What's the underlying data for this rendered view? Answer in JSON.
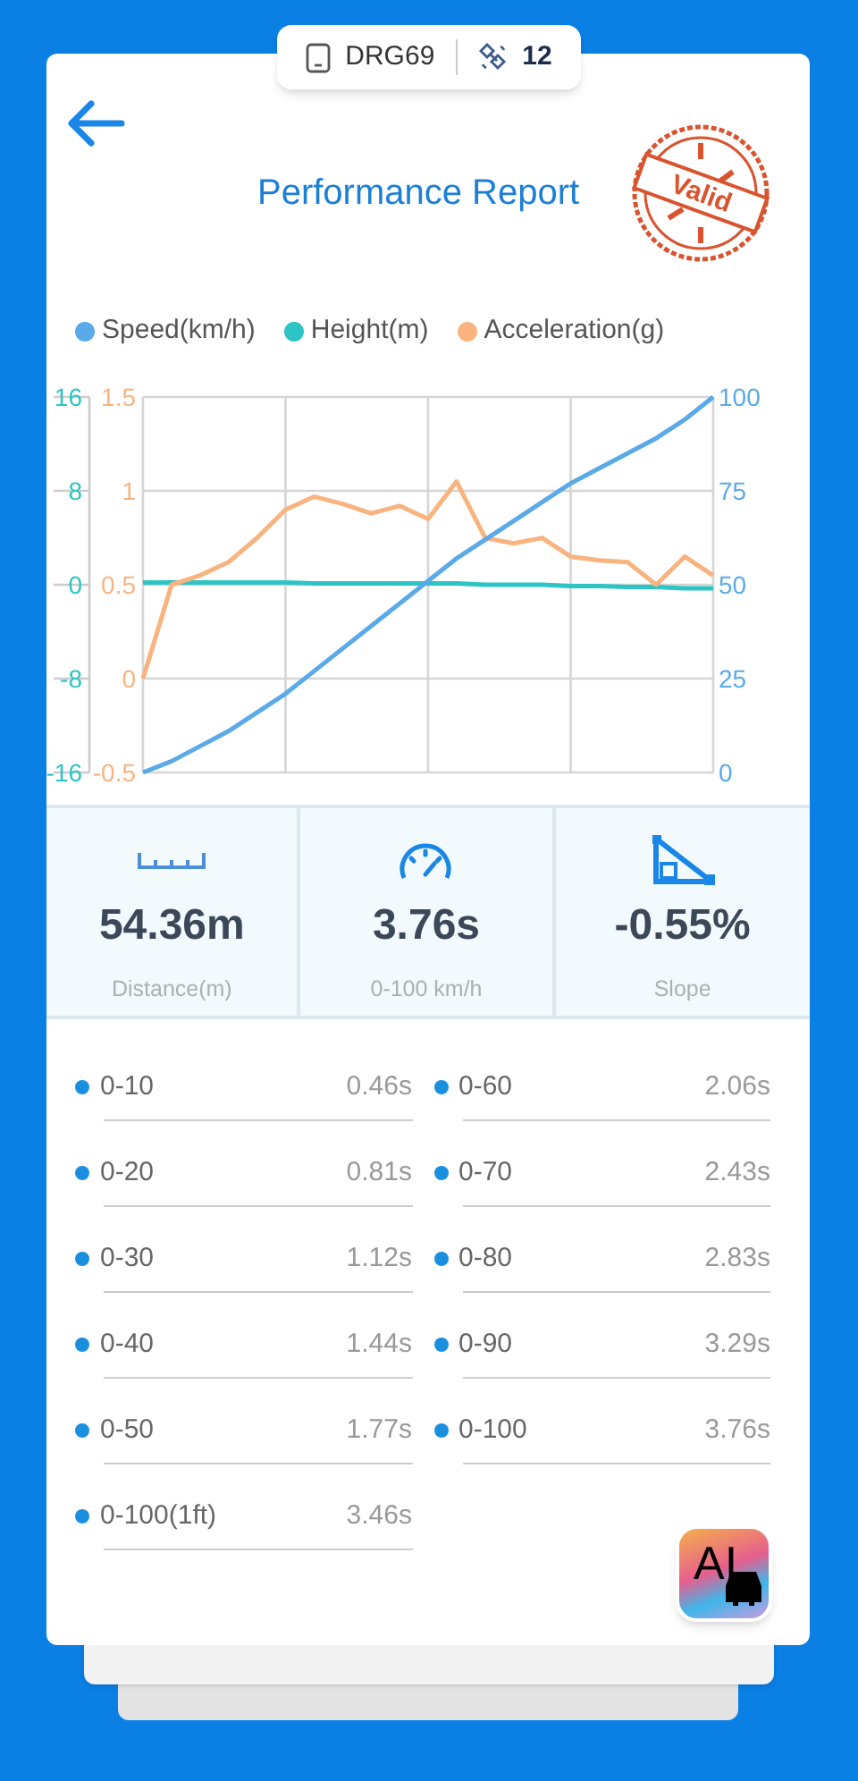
{
  "device_bar": {
    "device": "DRG69",
    "satellites": "12"
  },
  "header": {
    "title": "Performance Report",
    "stamp": "Valid"
  },
  "chart": {
    "speed": {
      "chart_data": {
        "type": "line",
        "categories": [
          null,
          null,
          null,
          null,
          null,
          null,
          null,
          null,
          null,
          null,
          null,
          null,
          null,
          null,
          null,
          null,
          null,
          null,
          null,
          null,
          null
        ],
        "ylim": [
          0,
          100
        ],
        "yticks": [
          0,
          25,
          50,
          75,
          100
        ],
        "series": [
          {
            "name": "Speed(km/h)",
            "color": "#5aa9e8",
            "values": [
              0,
              3,
              7,
              11,
              16,
              21,
              27,
              33,
              39,
              45,
              51,
              57,
              62,
              67,
              72,
              77,
              81,
              85,
              89,
              94,
              100
            ]
          }
        ]
      }
    },
    "height": {
      "chart_data": {
        "type": "line",
        "categories": [
          null,
          null,
          null,
          null,
          null,
          null,
          null,
          null,
          null,
          null,
          null,
          null,
          null,
          null,
          null,
          null,
          null,
          null,
          null,
          null,
          null
        ],
        "ylim": [
          -16,
          16
        ],
        "yticks": [
          -16,
          -8,
          0,
          8,
          16
        ],
        "grid": true,
        "series": [
          {
            "name": "Height(m)",
            "color": "#2cc4c4",
            "values": [
              0.2,
              0.2,
              0.2,
              0.2,
              0.2,
              0.2,
              0.1,
              0.1,
              0.1,
              0.1,
              0.1,
              0.1,
              0,
              0,
              0,
              -0.1,
              -0.1,
              -0.2,
              -0.2,
              -0.3,
              -0.3
            ]
          }
        ]
      }
    },
    "acceleration": {
      "chart_data": {
        "type": "line",
        "categories": [
          null,
          null,
          null,
          null,
          null,
          null,
          null,
          null,
          null,
          null,
          null,
          null,
          null,
          null,
          null,
          null,
          null,
          null,
          null,
          null,
          null
        ],
        "ylim": [
          -0.5,
          1.5
        ],
        "yticks": [
          -0.5,
          0,
          0.5,
          1,
          1.5
        ],
        "series": [
          {
            "name": "Acceleration(g)",
            "color": "#f9b37e",
            "values": [
              0,
              0.5,
              0.55,
              0.62,
              0.75,
              0.9,
              0.97,
              0.93,
              0.88,
              0.92,
              0.85,
              1.05,
              0.75,
              0.72,
              0.75,
              0.65,
              0.63,
              0.62,
              0.5,
              0.65,
              0.55
            ]
          }
        ]
      }
    }
  },
  "stats": [
    {
      "kind": "ruler",
      "value": "54.36m",
      "label": "Distance(m)"
    },
    {
      "kind": "gauge",
      "value": "3.76s",
      "label": "0-100 km/h"
    },
    {
      "kind": "slope",
      "value": "-0.55%",
      "label": "Slope"
    }
  ],
  "splits": [
    {
      "range": "0-10",
      "time": "0.46s"
    },
    {
      "range": "0-60",
      "time": "2.06s"
    },
    {
      "range": "0-20",
      "time": "0.81s"
    },
    {
      "range": "0-70",
      "time": "2.43s"
    },
    {
      "range": "0-30",
      "time": "1.12s"
    },
    {
      "range": "0-80",
      "time": "2.83s"
    },
    {
      "range": "0-40",
      "time": "1.44s"
    },
    {
      "range": "0-90",
      "time": "3.29s"
    },
    {
      "range": "0-50",
      "time": "1.77s"
    },
    {
      "range": "0-100",
      "time": "3.76s"
    },
    {
      "range": "0-100(1ft)",
      "time": "3.46s"
    }
  ],
  "ai_button": {
    "label": "AI"
  }
}
